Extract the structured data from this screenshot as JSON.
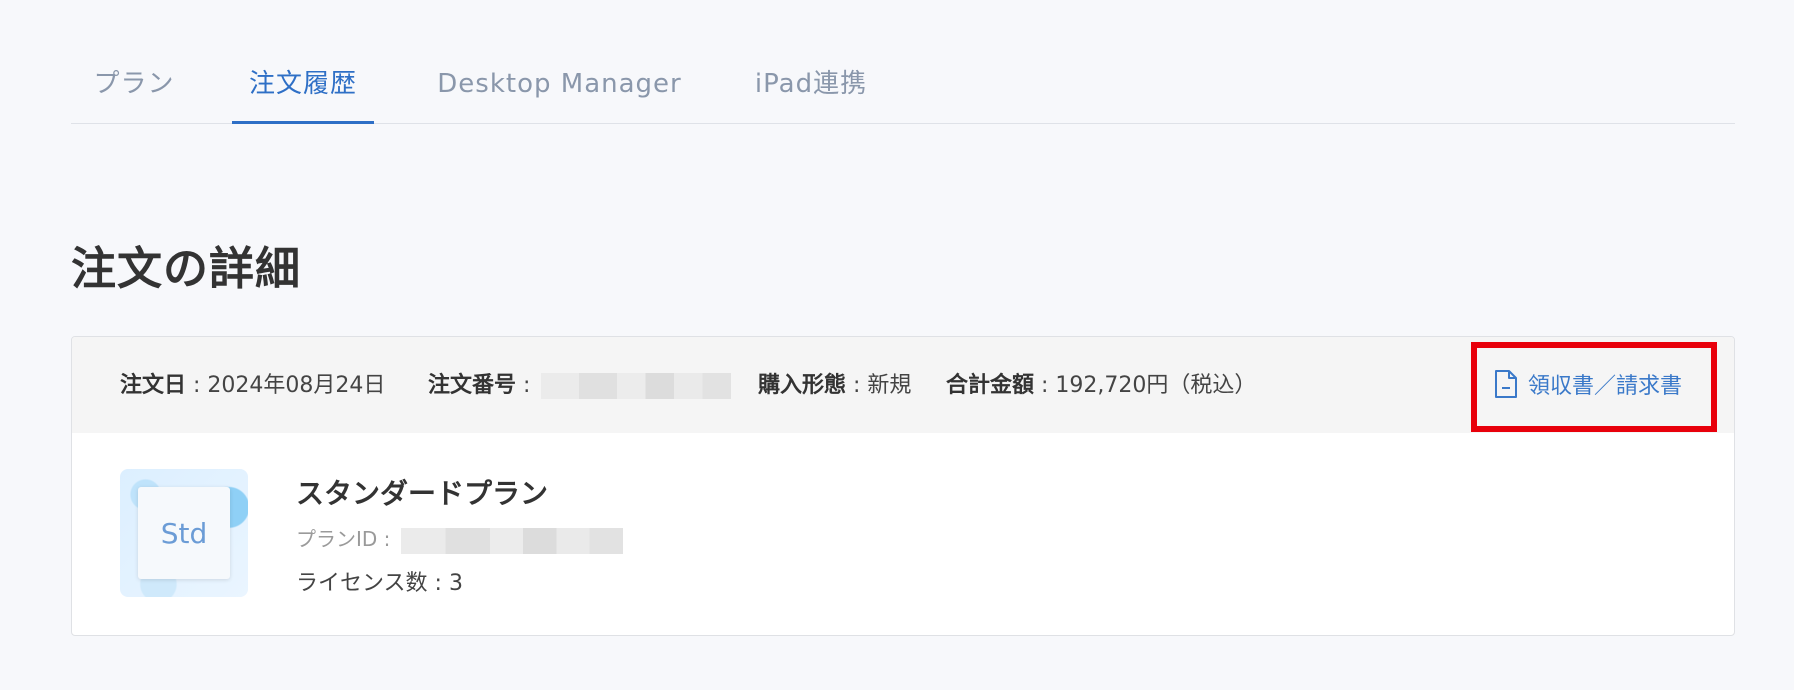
{
  "tabs": [
    {
      "label": "プラン"
    },
    {
      "label": "注文履歴"
    },
    {
      "label": "Desktop Manager"
    },
    {
      "label": "iPad連携"
    }
  ],
  "active_tab": "注文履歴",
  "page_title": "注文の詳細",
  "order": {
    "date_label": "注文日",
    "date_value": "2024年08月24日",
    "number_label": "注文番号",
    "type_label": "購入形態",
    "type_value": "新規",
    "total_label": "合計金額",
    "total_value": "192,720円（税込）",
    "separator": " : ",
    "receipt_label": "領収書／請求書"
  },
  "item": {
    "thumb_text": "Std",
    "name": "スタンダードプラン",
    "plan_id_label": "プランID : ",
    "license_label": "ライセンス数 : ",
    "license_count": "3"
  },
  "colors": {
    "accent": "#2e6fc6",
    "highlight_border": "#e8000b",
    "background": "#f7f8fb"
  }
}
